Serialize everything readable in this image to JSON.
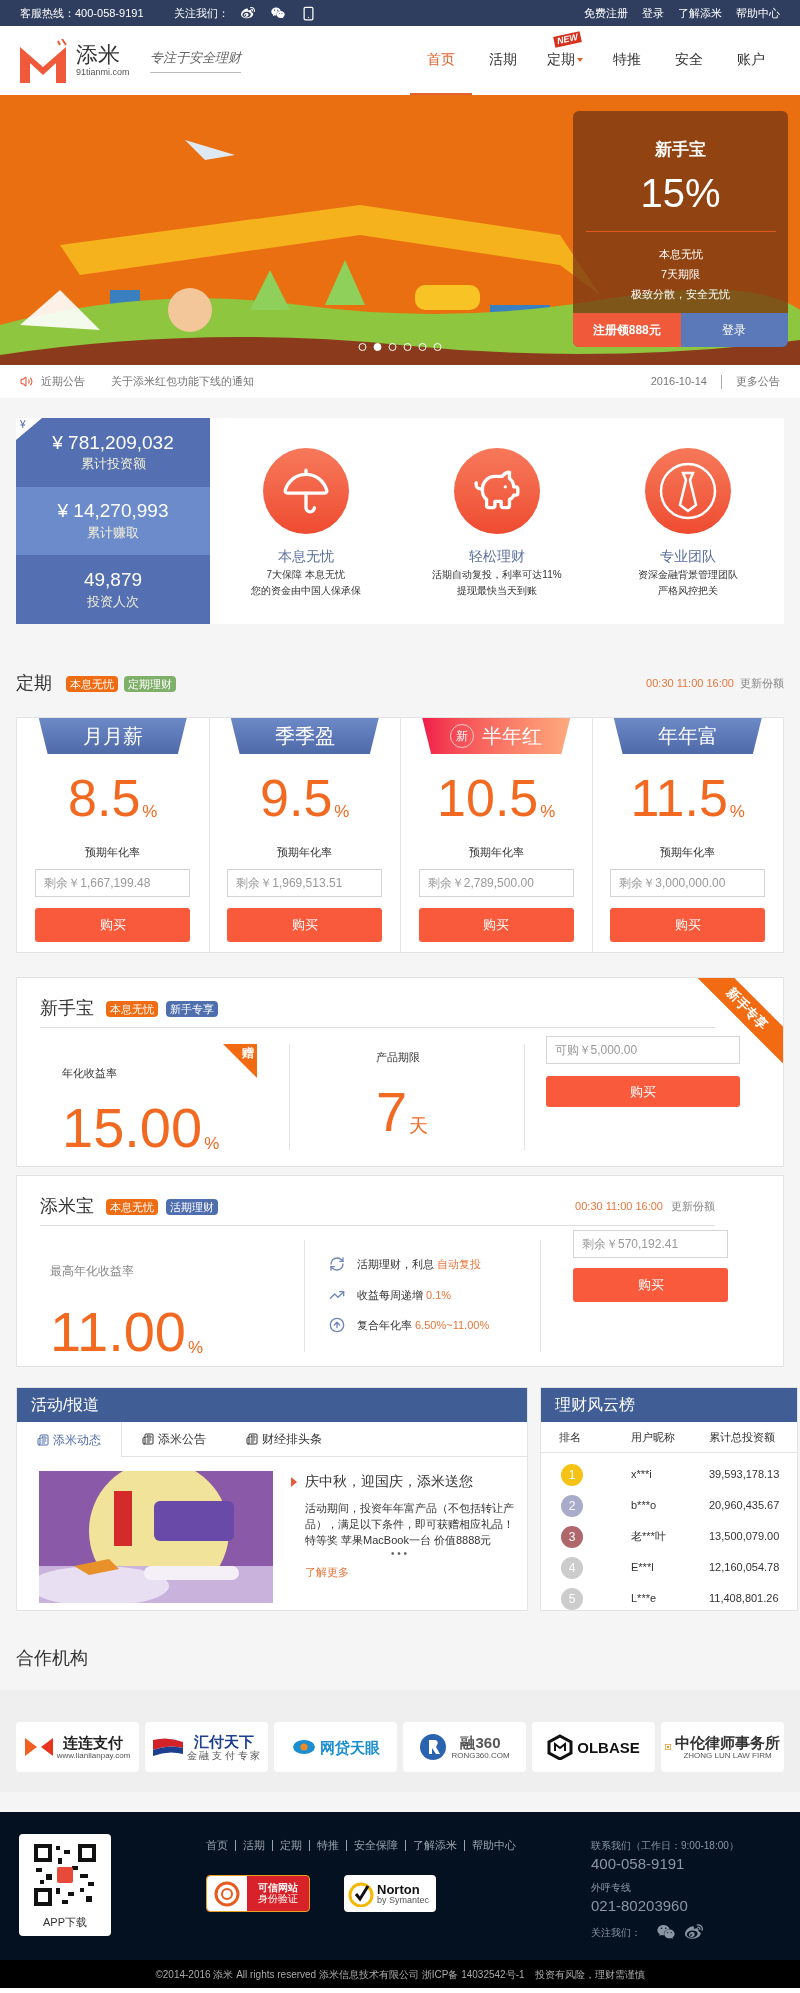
{
  "top_bar": {
    "hotline": "客服热线：400-058-9191",
    "follow": "关注我们：",
    "links": [
      "免费注册",
      "登录",
      "了解添米",
      "帮助中心"
    ]
  },
  "header": {
    "logo_name": "添米",
    "logo_domain": "91tianmi.com",
    "slogan": "专注于安全理财",
    "nav": [
      {
        "label": "首页",
        "selected": true,
        "dropdown": false
      },
      {
        "label": "活期",
        "selected": false,
        "dropdown": false
      },
      {
        "label": "定期",
        "selected": false,
        "dropdown": true,
        "badge": "NEW"
      },
      {
        "label": "特推",
        "selected": false,
        "dropdown": false
      },
      {
        "label": "安全",
        "selected": false,
        "dropdown": false
      },
      {
        "label": "账户",
        "selected": false,
        "dropdown": false
      }
    ]
  },
  "banner": {
    "carousel_dots": [
      {
        "selected": false
      },
      {
        "selected": true
      },
      {
        "selected": false
      },
      {
        "selected": false
      },
      {
        "selected": false
      },
      {
        "selected": false
      }
    ],
    "promo": {
      "title": "新手宝",
      "rate": "15%",
      "features": [
        "本息无忧",
        "7天期限",
        "极致分散，安全无忧"
      ],
      "register_button": "注册领888元",
      "login_button": "登录"
    }
  },
  "notice": {
    "label": "近期公告",
    "text": "关于添米红包功能下线的通知",
    "date": "2016-10-14",
    "more": "更多公告"
  },
  "stats": {
    "corner": "¥",
    "items": [
      {
        "value": "¥ 781,209,032",
        "label": "累计投资额",
        "selected": false
      },
      {
        "value": "¥ 14,270,993",
        "label": "累计赚取",
        "selected": true
      },
      {
        "value": "49,879",
        "label": "投资人次",
        "selected": false
      }
    ]
  },
  "features": [
    {
      "kind": "umbrella",
      "title": "本息无忧",
      "lines": [
        "7大保障 本息无忧",
        "您的资金由中国人保承保"
      ]
    },
    {
      "kind": "piggy",
      "title": "轻松理财",
      "lines": [
        "活期自动复投，利率可达11%",
        "提现最快当天到账"
      ]
    },
    {
      "kind": "tie",
      "title": "专业团队",
      "lines": [
        "资深金融背景管理团队",
        "严格风控把关"
      ]
    }
  ],
  "fixed": {
    "title": "定期",
    "tags": [
      {
        "text": "本息无忧",
        "color": "#f06c12"
      },
      {
        "text": "定期理财",
        "color": "#7fb069"
      }
    ],
    "schedule": "00:30 11:00 16:00",
    "schedule_label": "更新份额",
    "products": [
      {
        "name": "月月薪",
        "highlight": false,
        "rate": "8.5",
        "unit": "%",
        "rate_label": "预期年化率",
        "placeholder": "剩余￥1,667,199.48",
        "button": "购买"
      },
      {
        "name": "季季盈",
        "highlight": false,
        "rate": "9.5",
        "unit": "%",
        "rate_label": "预期年化率",
        "placeholder": "剩余￥1,969,513.51",
        "button": "购买"
      },
      {
        "name": "半年红",
        "highlight": true,
        "badge": "新",
        "rate": "10.5",
        "unit": "%",
        "rate_label": "预期年化率",
        "placeholder": "剩余￥2,789,500.00",
        "button": "购买"
      },
      {
        "name": "年年富",
        "highlight": false,
        "rate": "11.5",
        "unit": "%",
        "rate_label": "预期年化率",
        "placeholder": "剩余￥3,000,000.00",
        "button": "购买"
      }
    ]
  },
  "novice": {
    "title": "新手宝",
    "tags": [
      {
        "text": "本息无忧",
        "color": "#f06c12"
      },
      {
        "text": "新手专享",
        "color": "#4f6eae"
      }
    ],
    "ribbon": "新手专享",
    "rate_label": "年化收益率",
    "gift": "赠",
    "rate": "15.00",
    "rate_unit": "%",
    "term_label": "产品期限",
    "term": "7",
    "term_unit": "天",
    "placeholder": "可购￥5,000.00",
    "button": "购买"
  },
  "tianmibao": {
    "title": "添米宝",
    "tags": [
      {
        "text": "本息无忧",
        "color": "#f06c12"
      },
      {
        "text": "活期理财",
        "color": "#4f6eae"
      }
    ],
    "schedule": "00:30 11:00 16:00",
    "schedule_label": "更新份额",
    "rate_label": "最高年化收益率",
    "rate": "11.00",
    "rate_unit": "%",
    "features": [
      {
        "kind": "recycle",
        "text": "活期理财，利息",
        "highlight": "自动复投"
      },
      {
        "kind": "chart",
        "text": "收益每周递增",
        "highlight": "0.1%"
      },
      {
        "kind": "up",
        "text": "复合年化率",
        "highlight": "6.50%~11.00%"
      }
    ],
    "placeholder": "剩余￥570,192.41",
    "button": "购买"
  },
  "news": {
    "title": "活动/报道",
    "tabs": [
      {
        "label": "添米动态",
        "selected": true
      },
      {
        "label": "添米公告",
        "selected": false
      },
      {
        "label": "财经排头条",
        "selected": false
      }
    ],
    "article": {
      "title": "庆中秋，迎国庆，添米送您",
      "body": "活动期间，投资年年富产品（不包括转让产品），满足以下条件，即可获赠相应礼品！特等奖 苹果MacBook一台 价值8888元",
      "ellipsis": "• • •",
      "more": "了解更多"
    }
  },
  "ranking": {
    "title": "理财风云榜",
    "columns": [
      "排名",
      "用户昵称",
      "累计总投资额"
    ],
    "rows": [
      {
        "rank": "1",
        "color": "#f5c216",
        "user": "x***i",
        "amount": "39,593,178.13"
      },
      {
        "rank": "2",
        "color": "#a9abcb",
        "user": "b***o",
        "amount": "20,960,435.67"
      },
      {
        "rank": "3",
        "color": "#b0676c",
        "user": "老***叶",
        "amount": "13,500,079.00"
      },
      {
        "rank": "4",
        "color": "#cccccc",
        "user": "E***l",
        "amount": "12,160,054.78"
      },
      {
        "rank": "5",
        "color": "#cccccc",
        "user": "L***e",
        "amount": "11,408,801.26"
      }
    ]
  },
  "partners": {
    "title": "合作机构",
    "items": [
      {
        "kind": "lianlian",
        "name": "连连支付",
        "sub": "www.lianlianpay.com"
      },
      {
        "kind": "huifu",
        "name": "汇付天下",
        "sub": "金 融 支 付 专 家"
      },
      {
        "kind": "wangdai",
        "name": "网贷天眼"
      },
      {
        "kind": "rong360",
        "name": "融360",
        "sub": "RONG360.COM"
      },
      {
        "kind": "molbase",
        "name": "OLBASE"
      },
      {
        "kind": "zhonglun",
        "name": "中伦律师事务所",
        "sub": "ZHONG LUN LAW FIRM"
      }
    ]
  },
  "footer": {
    "app_label": "APP下载",
    "links": [
      "首页",
      "活期",
      "定期",
      "特推",
      "安全保障",
      "了解添米",
      "帮助中心"
    ],
    "badges": [
      {
        "kind": "trusted",
        "title": "可信网站",
        "sub": "身份验证"
      },
      {
        "kind": "norton",
        "title": "Norton",
        "sub": "by Symantec"
      }
    ],
    "contact_label": "联系我们",
    "hours": "（工作日：9:00-18:00）",
    "phone": "400-058-9191",
    "outbound_label": "外呼专线",
    "outbound": "021-80203960",
    "follow": "关注我们：",
    "copyright": "©2014-2016 添米 All rights reserved 添米信息技术有限公司 浙ICP备 14032542号-1　投资有风险，理财需谨慎"
  }
}
